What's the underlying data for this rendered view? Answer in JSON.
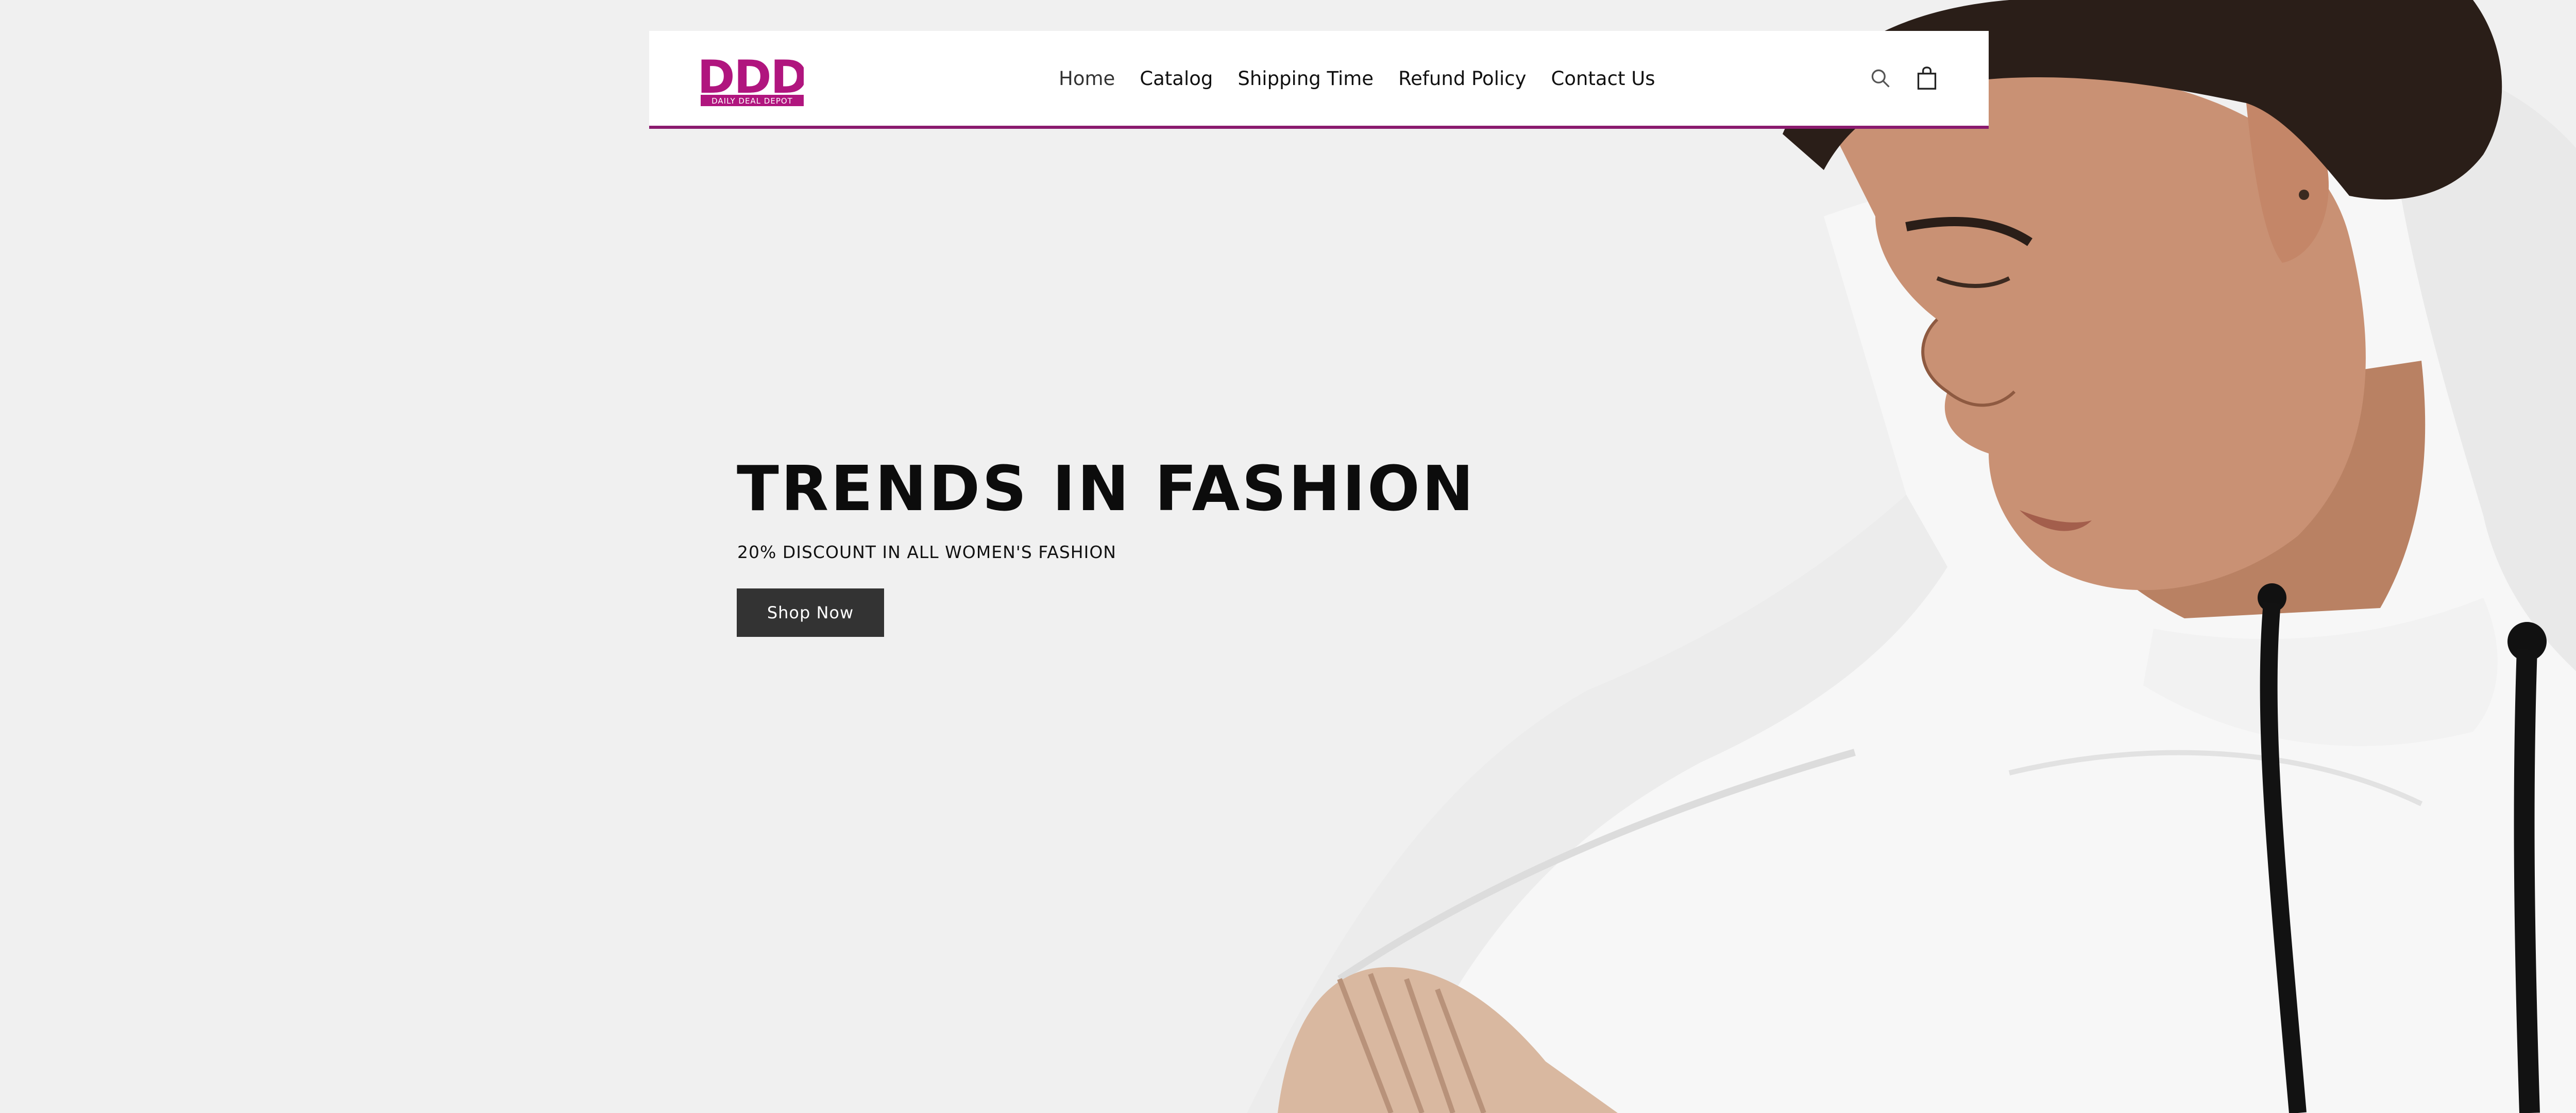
{
  "brand": {
    "logo_letters": "DDD",
    "logo_tagline": "DAILY DEAL DEPOT",
    "primary_color": "#b0157e",
    "accent_color": "#8a1a6e"
  },
  "nav": {
    "items": [
      {
        "label": "Home",
        "active": true
      },
      {
        "label": "Catalog"
      },
      {
        "label": "Shipping Time"
      },
      {
        "label": "Refund Policy"
      },
      {
        "label": "Contact Us"
      }
    ]
  },
  "header_icons": {
    "search": "search-icon",
    "cart": "shopping-bag-icon"
  },
  "hero": {
    "title": "TRENDS IN FASHION",
    "subtitle": "20% DISCOUNT IN ALL WOMEN'S FASHION",
    "cta_label": "Shop Now",
    "cta_color": "#333333"
  }
}
